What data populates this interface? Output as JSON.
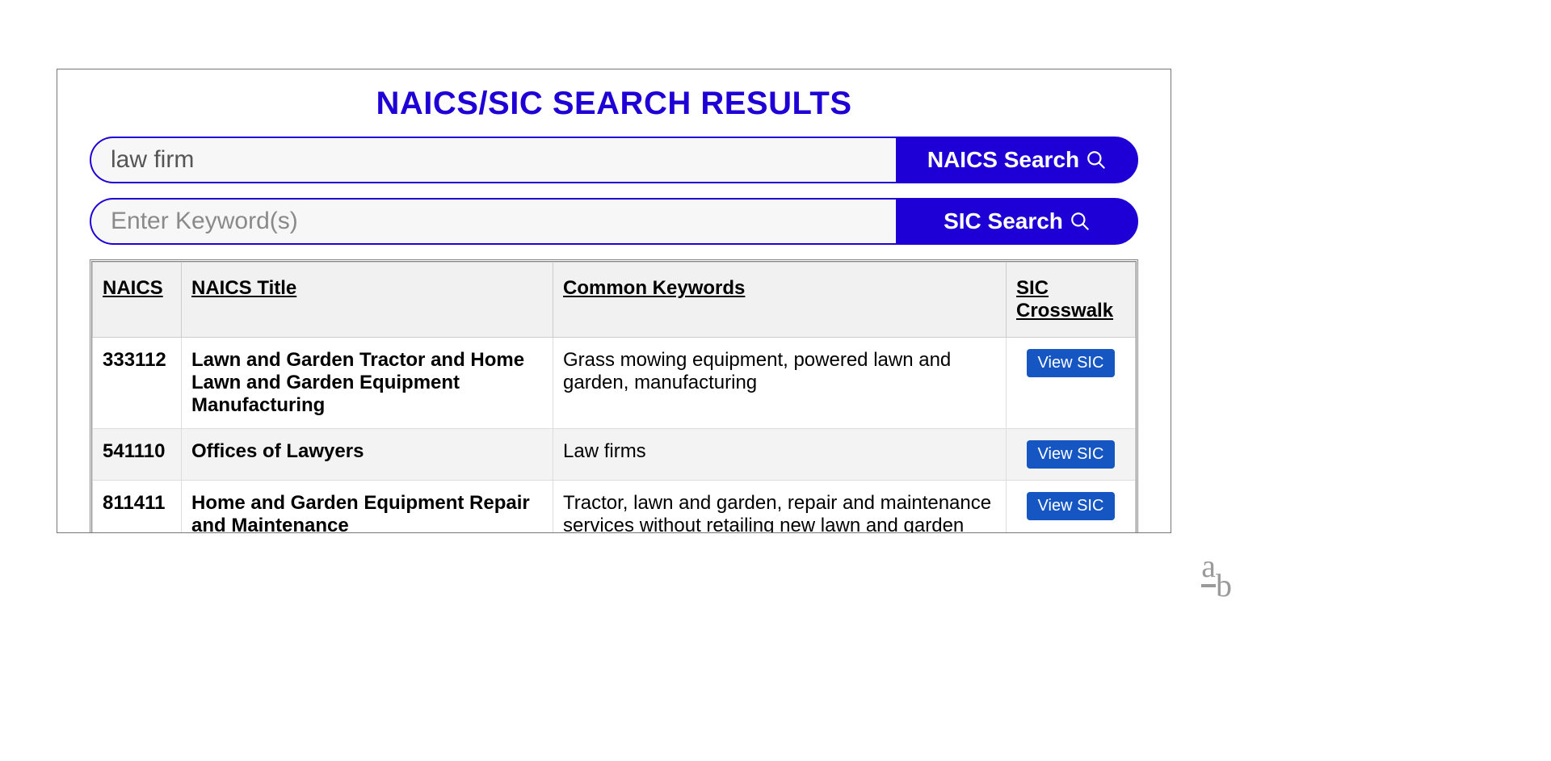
{
  "title": "NAICS/SIC SEARCH RESULTS",
  "search": {
    "naics": {
      "value": "law firm",
      "button": "NAICS Search"
    },
    "sic": {
      "value": "",
      "placeholder": "Enter Keyword(s)",
      "button": "SIC Search"
    }
  },
  "table": {
    "headers": {
      "naics": "NAICS",
      "title": "NAICS Title",
      "keywords": "Common Keywords",
      "sic": "SIC Crosswalk"
    },
    "view_sic_label": "View SIC",
    "rows": [
      {
        "code": "333112",
        "title": "Lawn and Garden Tractor and Home Lawn and Garden Equipment Manufacturing",
        "keywords": "Grass mowing equipment, powered lawn and garden, manufacturing"
      },
      {
        "code": "541110",
        "title": "Offices of Lawyers",
        "keywords": "Law firms"
      },
      {
        "code": "811411",
        "title": "Home and Garden Equipment Repair and Maintenance",
        "keywords": "Tractor, lawn and garden, repair and maintenance services without retailing new lawn and garden tractors"
      }
    ]
  },
  "footer_mark": {
    "a": "a",
    "b": "b"
  }
}
